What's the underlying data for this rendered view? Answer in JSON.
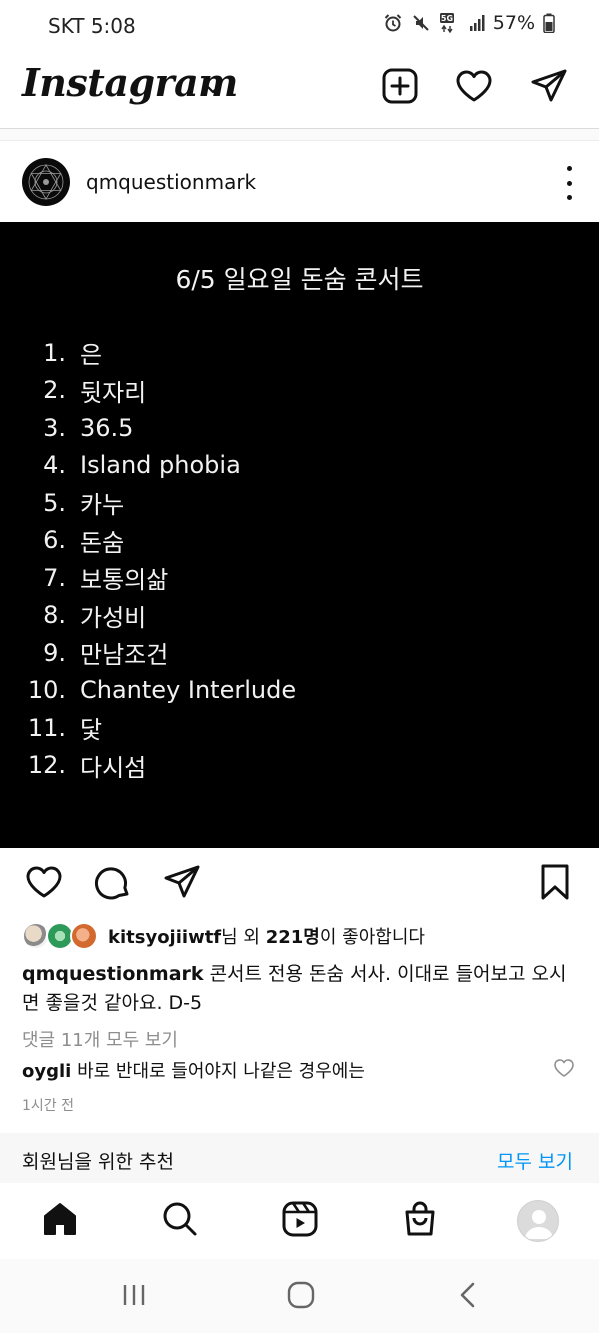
{
  "status_bar": {
    "carrier_time": "SKT 5:08",
    "network": "5G",
    "battery": "57%"
  },
  "header": {
    "logo": "Instagram",
    "icons": [
      "chevron-down-icon",
      "new-post-icon",
      "heart-icon",
      "direct-message-icon"
    ]
  },
  "post": {
    "username": "qmquestionmark",
    "image": {
      "title": "6/5 일요일 돈숨 콘서트",
      "setlist": [
        {
          "num": "1.",
          "song": "은"
        },
        {
          "num": "2.",
          "song": "뒷자리"
        },
        {
          "num": "3.",
          "song": "36.5"
        },
        {
          "num": "4.",
          "song": "Island phobia"
        },
        {
          "num": "5.",
          "song": "카누"
        },
        {
          "num": "6.",
          "song": "돈숨"
        },
        {
          "num": "7.",
          "song": "보통의삶"
        },
        {
          "num": "8.",
          "song": "가성비"
        },
        {
          "num": "9.",
          "song": "만남조건"
        },
        {
          "num": "10.",
          "song": "Chantey Interlude"
        },
        {
          "num": "11.",
          "song": "닻"
        },
        {
          "num": "12.",
          "song": "다시섬"
        }
      ]
    },
    "likes": {
      "first_liker": "kitsyojiiwtf",
      "suffix_1": "님 외 ",
      "count": "221명",
      "suffix_2": "이 좋아합니다"
    },
    "caption": {
      "username": "qmquestionmark",
      "text": "콘서트 전용 돈숨 서사. 이대로 들어보고 오시면 좋을것 같아요. D-5"
    },
    "view_all_comments": "댓글 11개 모두 보기",
    "comment": {
      "username": "oygli",
      "text": "바로 반대로 들어야지 나같은 경우에는"
    },
    "time_ago": "1시간 전"
  },
  "suggestions": {
    "title": "회원님을 위한 추천",
    "view_all": "모두 보기"
  },
  "colors": {
    "link_blue": "#0095f6",
    "muted_gray": "#8e8e8e",
    "image_bg": "#000000"
  }
}
